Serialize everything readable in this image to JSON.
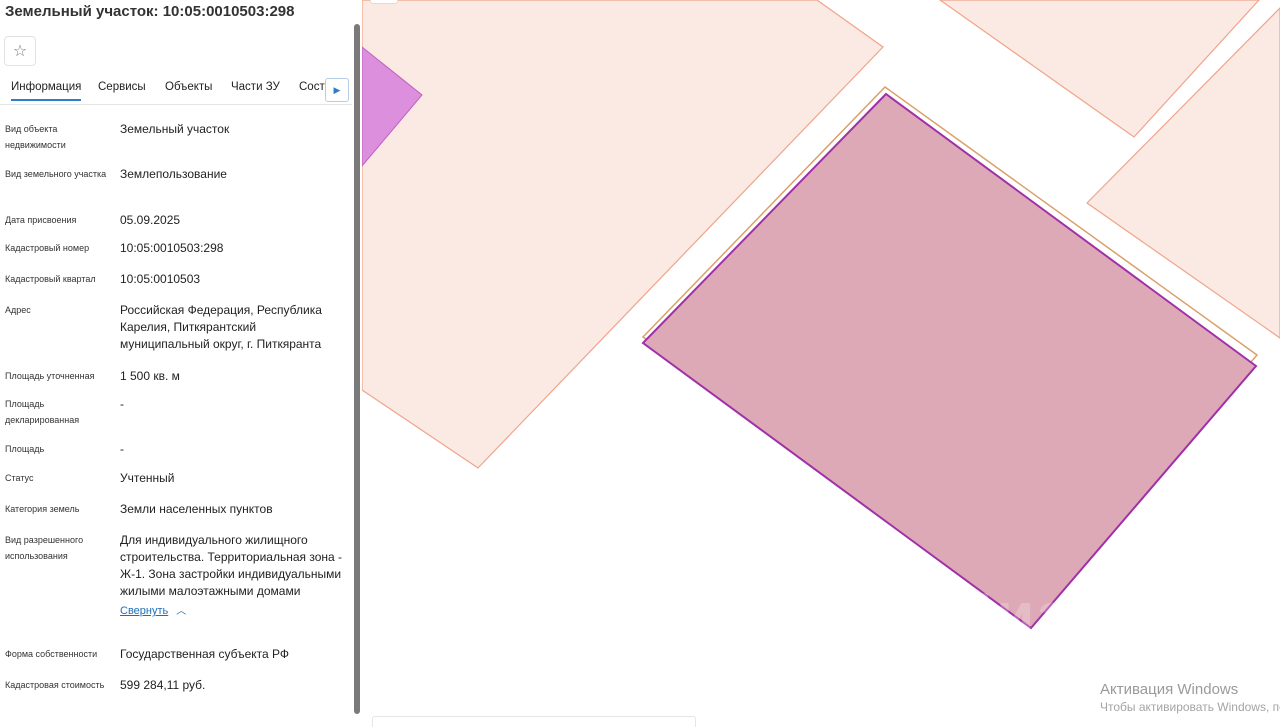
{
  "panel": {
    "title": "Земельный участок: 10:05:0010503:298",
    "tabs": [
      {
        "label": "Информация",
        "active": true
      },
      {
        "label": "Сервисы",
        "active": false
      },
      {
        "label": "Объекты",
        "active": false
      },
      {
        "label": "Части ЗУ",
        "active": false
      },
      {
        "label": "Соста",
        "active": false
      }
    ],
    "fields": [
      {
        "label": "Вид объекта недвижимости",
        "value": "Земельный участок"
      },
      {
        "label": "Вид земельного участка",
        "value": "Землепользование"
      },
      {
        "label": "Дата присвоения",
        "value": "05.09.2025"
      },
      {
        "label": "Кадастровый номер",
        "value": "10:05:0010503:298"
      },
      {
        "label": "Кадастровый квартал",
        "value": "10:05:0010503"
      },
      {
        "label": "Адрес",
        "value": "Российская Федерация, Республика Карелия, Питкярантский муниципальный округ, г. Питкяранта"
      },
      {
        "label": "Площадь уточненная",
        "value": "1 500 кв. м"
      },
      {
        "label": "Площадь декларированная",
        "value": "-"
      },
      {
        "label": "Площадь",
        "value": "-"
      },
      {
        "label": "Статус",
        "value": "Учтенный"
      },
      {
        "label": "Категория земель",
        "value": "Земли населенных пунктов"
      },
      {
        "label": "Вид разрешенного использования",
        "value": "Для индивидуального жилищного строительства. Территориальная зона - Ж-1. Зона застройки индивидуальными жилыми малоэтажными домами"
      },
      {
        "label": "Форма собственности",
        "value": "Государственная субъекта РФ"
      },
      {
        "label": "Кадастровая стоимость",
        "value": "599 284,11 руб."
      }
    ],
    "collapse_link": "Свернуть"
  },
  "map": {
    "colors": {
      "neighbor_fill": "#fbe9e4",
      "neighbor_stroke": "#f0a48a",
      "selected_fill": "#dea9b7",
      "selected_stroke": "#a030a8",
      "magenta_zone": "#dc8fdc"
    },
    "watermark": "Циан",
    "activation_title": "Активация Windows",
    "activation_sub": "Чтобы активировать Windows, перейдите в раздел «Параметры»."
  }
}
